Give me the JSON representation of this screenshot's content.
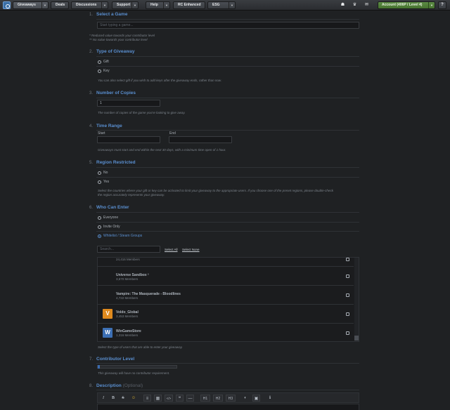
{
  "nav": {
    "items": [
      {
        "label": "Giveaways",
        "dropdown": true,
        "active": true
      },
      {
        "label": "Deals",
        "dropdown": false
      },
      {
        "label": "Discussions",
        "dropdown": true
      },
      {
        "label": "Support",
        "dropdown": true
      },
      {
        "label": "Help",
        "dropdown": true
      },
      {
        "label": "RC Enhanced",
        "dropdown": false
      },
      {
        "label": "ESG",
        "dropdown": true
      }
    ],
    "icons": [
      "gift-icon",
      "trophy-icon",
      "envelope-icon"
    ],
    "account_label": "Account (406P / Level 4)",
    "help_label": "?"
  },
  "sections": {
    "s1": {
      "num": "1.",
      "title": "Select a Game",
      "placeholder": "Start typing a game...",
      "note1": "* Reduced value towards your contributor level",
      "note2": "** No value towards your contributor level"
    },
    "s2": {
      "num": "2.",
      "title": "Type of Giveaway",
      "opt1": "Gift",
      "opt2": "Key",
      "hint": "You can also select gift if you wish to add keys after the giveaway ends, rather than now."
    },
    "s3": {
      "num": "3.",
      "title": "Number of Copies",
      "value": "1",
      "hint": "The number of copies of the game you're looking to give away."
    },
    "s4": {
      "num": "4.",
      "title": "Time Range",
      "start_label": "Start",
      "end_label": "End",
      "hint": "Giveaways must start and end within the next 30 days, with a minimum time open of 1 hour."
    },
    "s5": {
      "num": "5.",
      "title": "Region Restricted",
      "opt1": "No",
      "opt2": "Yes",
      "hint1": "Select the countries where your gift or key can be activated to limit your giveaway to the appropriate users. If you choose one of the preset regions, please double-check",
      "hint2": "the region accurately represents your giveaway."
    },
    "s6": {
      "num": "6.",
      "title": "Who Can Enter",
      "opt1": "Everyone",
      "opt2": "Invite Only",
      "opt3": "Whitelist / Steam Groups",
      "search_placeholder": "Search...",
      "select_all": "Select All",
      "select_none": "Select None",
      "hint": "Select the type of users that are able to enter your giveaway."
    },
    "s7": {
      "num": "7.",
      "title": "Contributor Level",
      "level_fraction": 0,
      "hint": "This giveaway will have no contributor requirement."
    },
    "s8": {
      "num": "8.",
      "title": "Description",
      "optional": "(Optional)"
    }
  },
  "groups": [
    {
      "name": "",
      "members": "24,416 Members",
      "icon": "none"
    },
    {
      "name": "Universe Sandbox ²",
      "members": "3,670 Members",
      "icon": "none"
    },
    {
      "name": "Vampire: The Masquerade - Bloodlines",
      "members": "4,722 Members",
      "icon": "none"
    },
    {
      "name": "Voldo_Global",
      "members": "3,453 Members",
      "icon": "V",
      "icon_color": "#e08a1e"
    },
    {
      "name": "WinGameStore",
      "members": "1,316 Members",
      "icon": "W",
      "icon_color": "#3c6fb4"
    }
  ],
  "toolbar": [
    "I",
    "B",
    "S",
    "☺",
    "≡",
    "▦",
    "</>",
    "❝",
    "—",
    "H1",
    "H2",
    "H3",
    "◐",
    "▣",
    "ℹ"
  ],
  "colors": {
    "accent": "#5a8fd0",
    "account": "#5c8c44"
  }
}
